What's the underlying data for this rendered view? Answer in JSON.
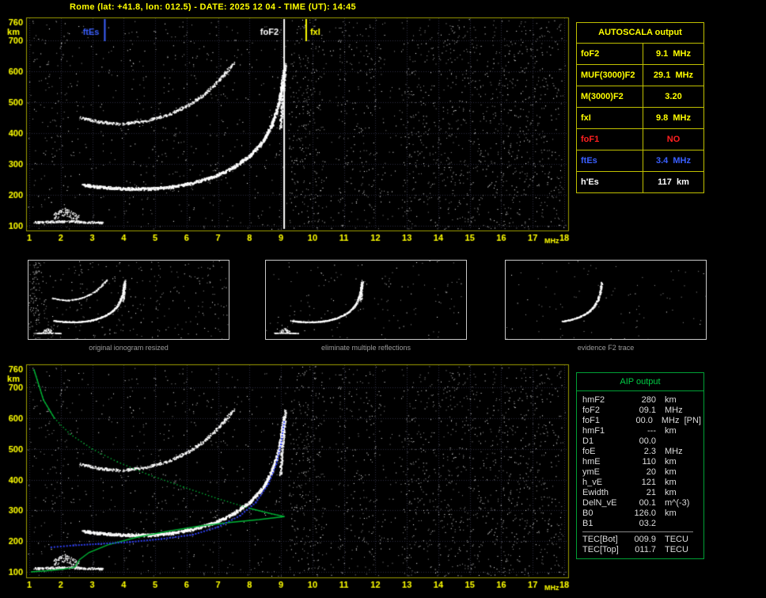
{
  "title": "Rome (lat: +41.8, lon: 012.5) - DATE: 2025 12 04 - TIME (UT): 14:45",
  "colors": {
    "background": "#000000",
    "title_text": "#ffff00",
    "plot_border": "#9c9c00",
    "grid": "#2c2c40",
    "axis_label": "#ffff00",
    "echo_white": "#ffffff",
    "profile_green": "#00b535",
    "restored_blue": "#2e3ef0",
    "caption_gray": "#9a9a9a",
    "autoscala_border": "#c0c000",
    "aip_border": "#00a035",
    "aip_title": "#00cc44",
    "aip_text": "#dcdcdc"
  },
  "autoscala": {
    "title": "AUTOSCALA output",
    "rows": [
      {
        "label": "foF2",
        "value": "9.1",
        "unit": "MHz",
        "color": "#ffff00"
      },
      {
        "label": "MUF(3000)F2",
        "value": "29.1",
        "unit": "MHz",
        "color": "#ffff00"
      },
      {
        "label": "M(3000)F2",
        "value": "3.20",
        "unit": "",
        "color": "#ffff00"
      },
      {
        "label": "fxI",
        "value": "9.8",
        "unit": "MHz",
        "color": "#ffff00"
      },
      {
        "label": "foF1",
        "value": "NO",
        "unit": "",
        "color": "#ff2020"
      },
      {
        "label": "ftEs",
        "value": "3.4",
        "unit": "MHz",
        "color": "#3a5fff"
      },
      {
        "label": "h'Es",
        "value": "117",
        "unit": "km",
        "color": "#ffffff"
      }
    ]
  },
  "aip": {
    "title": "AIP output",
    "rows": [
      {
        "name": "hmF2",
        "value": "280",
        "unit": "km"
      },
      {
        "name": "foF2",
        "value": "09.1",
        "unit": "MHz"
      },
      {
        "name": "foF1",
        "value": "00.0",
        "unit": "MHz  [PN]"
      },
      {
        "name": "hmF1",
        "value": "---",
        "unit": "km"
      },
      {
        "name": "D1",
        "value": "00.0",
        "unit": ""
      },
      {
        "name": "foE",
        "value": "2.3",
        "unit": "MHz"
      },
      {
        "name": "hmE",
        "value": "110",
        "unit": "km"
      },
      {
        "name": "ymE",
        "value": "20",
        "unit": "km"
      },
      {
        "name": "h_vE",
        "value": "121",
        "unit": "km"
      },
      {
        "name": "Ewidth",
        "value": "21",
        "unit": "km"
      },
      {
        "name": "DelN_vE",
        "value": "00.1",
        "unit": "m^(-3)"
      },
      {
        "name": "B0",
        "value": "126.0",
        "unit": "km"
      },
      {
        "name": "B1",
        "value": "03.2",
        "unit": ""
      },
      {
        "separator": true
      },
      {
        "name": "TEC[Bot]",
        "value": "009.9",
        "unit": "TECU"
      },
      {
        "name": "TEC[Top]",
        "value": "011.7",
        "unit": "TECU"
      }
    ]
  },
  "thumbs": [
    {
      "caption": "original ionogram resized",
      "traces": [
        "es",
        "es_blob",
        "f1",
        "f2nd",
        "asym"
      ],
      "noise": 300,
      "edge_noise": 90
    },
    {
      "caption": "eliminate multiple reflections",
      "traces": [
        "es",
        "es_blob",
        "f1",
        "asym"
      ],
      "noise": 150,
      "edge_noise": 0
    },
    {
      "caption": "evidence F2 trace",
      "traces": [
        "f1_tail"
      ],
      "noise": 90,
      "edge_noise": 0
    }
  ],
  "chart_data": {
    "type": "scatter",
    "xlabel": "MHz",
    "ylabel": "km",
    "xlim": [
      1,
      18
    ],
    "ylim": [
      100,
      760
    ],
    "x_ticks": [
      1,
      2,
      3,
      4,
      5,
      6,
      7,
      8,
      9,
      10,
      11,
      12,
      13,
      14,
      15,
      16,
      17,
      18
    ],
    "y_ticks": [
      100,
      200,
      300,
      400,
      500,
      600,
      700,
      760
    ],
    "markers": [
      {
        "label": "ftEs",
        "freq": 3.4,
        "color": "#3a5fff",
        "full": false,
        "side": "left"
      },
      {
        "label": "foF2",
        "freq": 9.1,
        "color": "#ffffff",
        "full": true,
        "side": "left"
      },
      {
        "label": "fxI",
        "freq": 9.8,
        "color": "#ffff00",
        "full": false,
        "side": "right"
      }
    ],
    "traces": {
      "es": {
        "points": [
          [
            1.15,
            112
          ],
          [
            1.7,
            114
          ],
          [
            2.2,
            116
          ],
          [
            2.7,
            113
          ],
          [
            3.35,
            111
          ]
        ],
        "spread": 7,
        "density": 2.6,
        "dot": 1.4
      },
      "es_blob": {
        "points": [
          [
            1.75,
            128
          ],
          [
            1.95,
            140
          ],
          [
            2.15,
            148
          ],
          [
            2.35,
            136
          ],
          [
            2.55,
            124
          ]
        ],
        "spread": 26,
        "density": 2.4,
        "dot": 1.4
      },
      "f1": {
        "points": [
          [
            2.7,
            233
          ],
          [
            3.3,
            226
          ],
          [
            4.0,
            221
          ],
          [
            4.8,
            221
          ],
          [
            5.5,
            227
          ],
          [
            6.2,
            240
          ],
          [
            6.9,
            262
          ],
          [
            7.5,
            292
          ],
          [
            8.0,
            328
          ],
          [
            8.4,
            372
          ],
          [
            8.7,
            430
          ],
          [
            8.9,
            490
          ],
          [
            9.0,
            545
          ],
          [
            9.08,
            605
          ]
        ],
        "spread": 9,
        "density": 3.2,
        "dot": 1.7
      },
      "f1_tail": {
        "points": [
          [
            5.5,
            227
          ],
          [
            6.2,
            240
          ],
          [
            6.9,
            262
          ],
          [
            7.5,
            292
          ],
          [
            8.0,
            328
          ],
          [
            8.4,
            372
          ],
          [
            8.7,
            430
          ],
          [
            8.9,
            490
          ],
          [
            9.0,
            545
          ],
          [
            9.08,
            605
          ]
        ],
        "spread": 9,
        "density": 3.0,
        "dot": 1.6
      },
      "f2nd": {
        "points": [
          [
            2.6,
            452
          ],
          [
            3.2,
            438
          ],
          [
            3.9,
            431
          ],
          [
            4.7,
            441
          ],
          [
            5.4,
            461
          ],
          [
            6.0,
            489
          ],
          [
            6.5,
            523
          ],
          [
            6.9,
            559
          ],
          [
            7.2,
            594
          ],
          [
            7.5,
            630
          ]
        ],
        "spread": 8,
        "density": 2.0,
        "dot": 1.5
      },
      "asym": {
        "points": [
          [
            8.97,
            420
          ],
          [
            9.03,
            500
          ],
          [
            9.08,
            565
          ],
          [
            9.13,
            625
          ]
        ],
        "spread": 16,
        "density": 2.4,
        "dot": 1.5
      }
    },
    "noise": {
      "uniform": 780,
      "bands": [
        {
          "f0": 9.25,
          "f1": 10.4,
          "count": 240
        },
        {
          "f0": 10.8,
          "f1": 12.3,
          "count": 170
        },
        {
          "f0": 12.8,
          "f1": 17.95,
          "count": 820
        },
        {
          "f0": 4.0,
          "f1": 9.0,
          "count": 150
        },
        {
          "f0": 1.05,
          "f1": 2.6,
          "count": 90
        }
      ]
    },
    "profile": {
      "topside": [
        [
          1.15,
          758
        ],
        [
          1.45,
          660
        ],
        [
          1.8,
          600
        ],
        [
          2.3,
          548
        ],
        [
          3.0,
          500
        ],
        [
          3.8,
          458
        ],
        [
          4.8,
          416
        ],
        [
          5.9,
          376
        ],
        [
          7.0,
          338
        ],
        [
          8.0,
          307
        ],
        [
          8.7,
          289
        ],
        [
          9.1,
          280
        ]
      ],
      "bottomside": [
        [
          1.05,
          100
        ],
        [
          1.6,
          104
        ],
        [
          2.1,
          109
        ],
        [
          2.3,
          112
        ],
        [
          2.45,
          116
        ],
        [
          2.6,
          140
        ],
        [
          2.9,
          163
        ],
        [
          3.5,
          188
        ],
        [
          4.4,
          212
        ],
        [
          5.4,
          232
        ],
        [
          6.4,
          249
        ],
        [
          7.4,
          261
        ],
        [
          8.3,
          270
        ],
        [
          9.1,
          280
        ]
      ],
      "restored": [
        [
          1.7,
          180
        ],
        [
          2.4,
          186
        ],
        [
          3.2,
          191
        ],
        [
          4.2,
          197
        ],
        [
          5.2,
          207
        ],
        [
          6.2,
          221
        ],
        [
          7.0,
          246
        ],
        [
          7.7,
          283
        ],
        [
          8.2,
          326
        ],
        [
          8.6,
          386
        ],
        [
          8.85,
          450
        ],
        [
          9.0,
          515
        ],
        [
          9.1,
          588
        ]
      ]
    }
  }
}
